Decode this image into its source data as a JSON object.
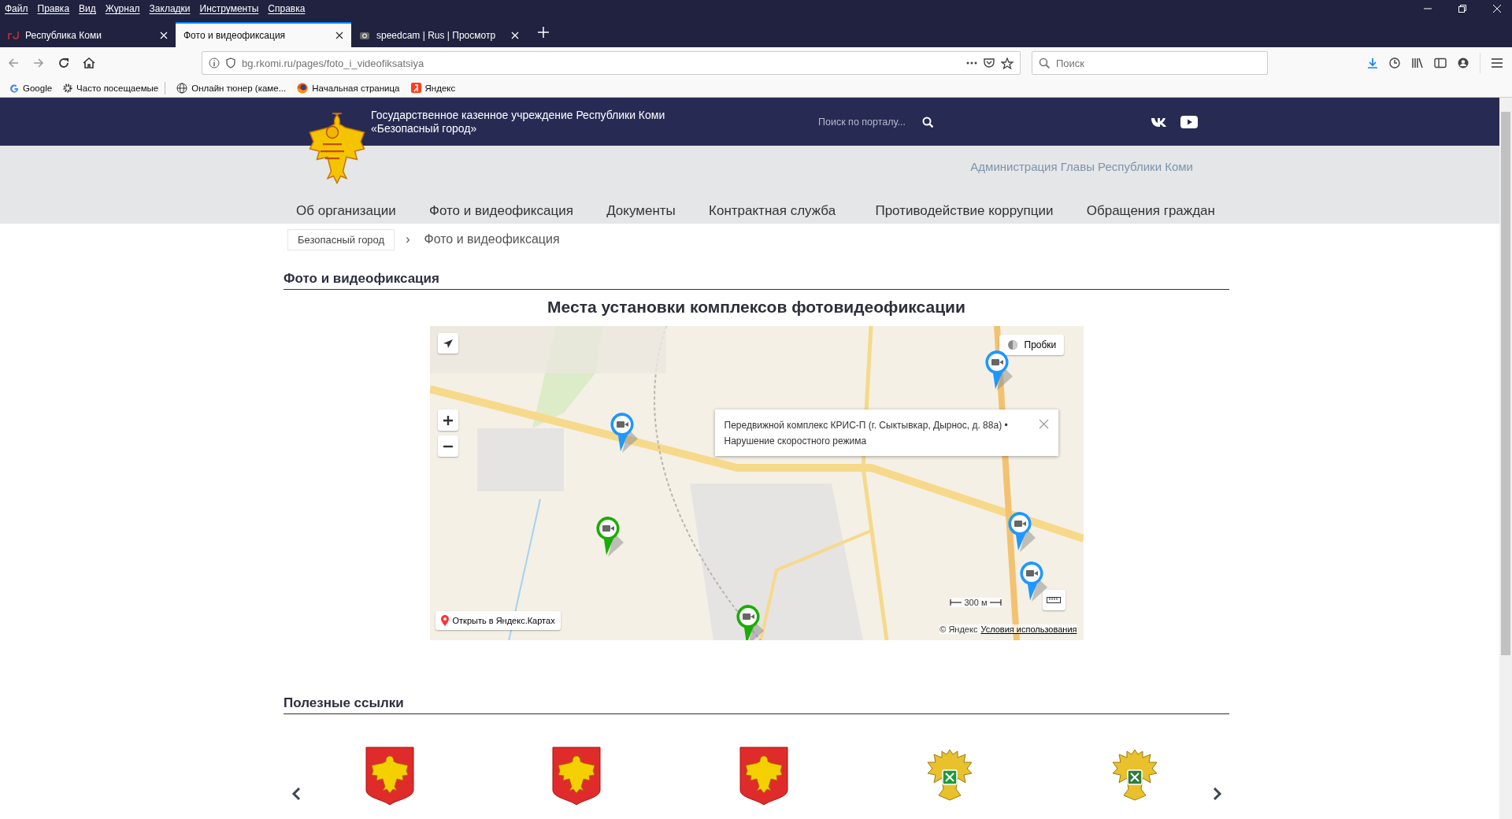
{
  "browser": {
    "menu": [
      "Файл",
      "Правка",
      "Вид",
      "Журнал",
      "Закладки",
      "Инструменты",
      "Справка"
    ],
    "tabs": [
      {
        "title": "Республика Коми",
        "selected": false,
        "kind": "rd"
      },
      {
        "title": "Фото и видеофиксация",
        "selected": true,
        "kind": "none"
      },
      {
        "title": "speedcam | Rus | Просмотр",
        "selected": false,
        "kind": "camera"
      }
    ],
    "url": "bg.rkomi.ru/pages/foto_i_videofiksatsiya",
    "search": {
      "placeholder": "Поиск"
    },
    "bookmarks": [
      {
        "label": "Google",
        "kind": "google"
      },
      {
        "label": "Часто посещаемые",
        "kind": "gear"
      },
      {
        "label": "Онлайн тюнер (каме...",
        "kind": "globe"
      },
      {
        "label": "Начальная страница",
        "kind": "firefox"
      },
      {
        "label": "Яндекс",
        "kind": "yandex"
      }
    ]
  },
  "site": {
    "title_lines": [
      "Государственное казенное учреждение Республики Коми",
      "«Безопасный город»"
    ],
    "search": {
      "placeholder": "Поиск по порталу..."
    },
    "admin_link": "Администрация Главы Республики Коми",
    "nav": [
      "Об организации",
      "Фото и видеофиксация",
      "Документы",
      "Контрактная служба",
      "Противодействие коррупции",
      "Обращения граждан"
    ],
    "breadcrumbs": [
      "Безопасный город",
      "Фото и видеофиксация"
    ],
    "breadcrumb_separator": "›"
  },
  "section_title": "Фото и видеофиксация",
  "map_title": "Места установки комплексов фотовидеофиксации",
  "map": {
    "traffic_button": "Пробки",
    "popup": {
      "lines": [
        "Передвижной комплекс КРИС-П (г. Сыктывкар, Дырнос, д. 88а) •",
        "Нарушение скоростного режима"
      ]
    },
    "open_link": "Открыть в Яндекс.Картах",
    "copyright": "© Яндекс",
    "terms_link": "Условия использования",
    "scale": "300 м",
    "pins": [
      {
        "color": "#1e98ff"
      },
      {
        "color": "#1e98ff"
      },
      {
        "color": "#1e98ff"
      },
      {
        "color": "#1bad03"
      },
      {
        "color": "#1e98ff"
      },
      {
        "color": "#1bad03"
      }
    ]
  },
  "useful_links": {
    "title": "Полезные ссылки",
    "logos": [
      {
        "kind": "komi"
      },
      {
        "kind": "komi"
      },
      {
        "kind": "komi"
      },
      {
        "kind": "eagle_green"
      },
      {
        "kind": "eagle_gold"
      }
    ]
  }
}
